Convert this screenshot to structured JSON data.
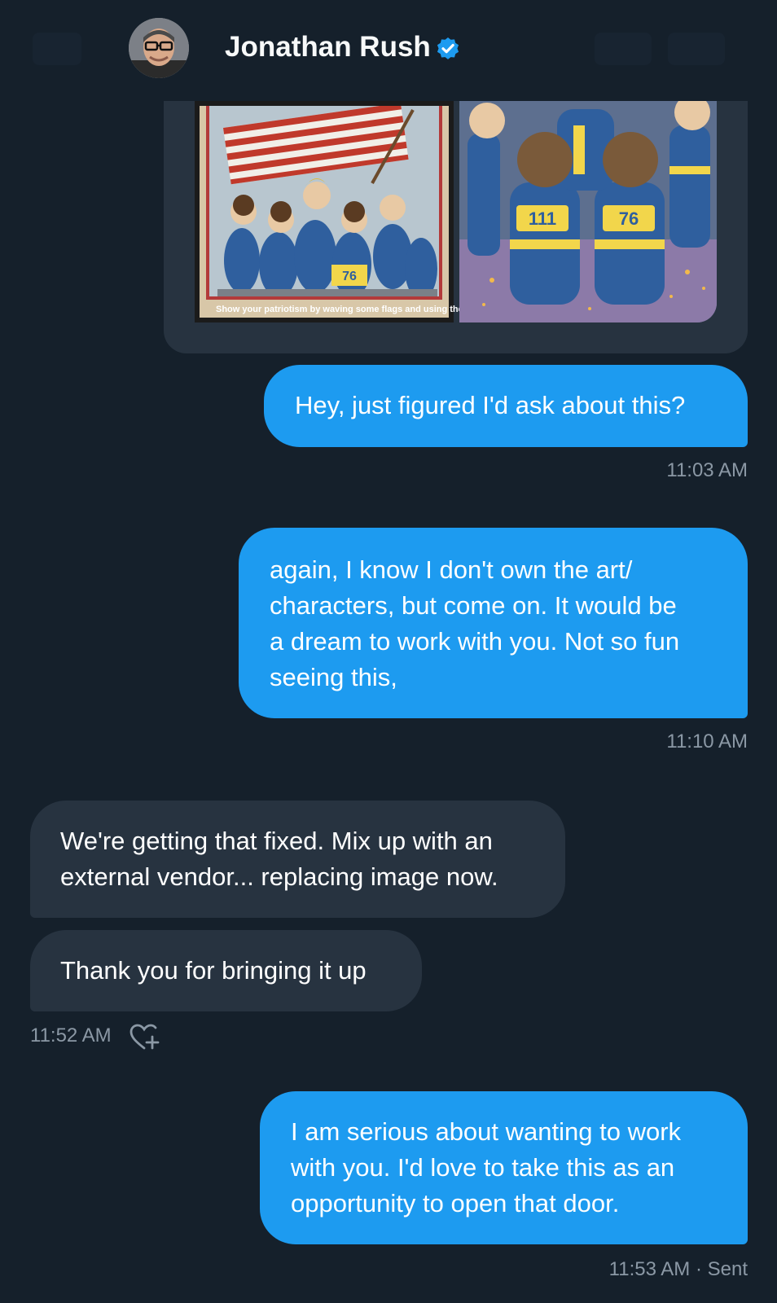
{
  "header": {
    "contact_name": "Jonathan Rush",
    "verified": true,
    "avatar_icon": "profile-photo"
  },
  "attachment": {
    "caption": "Show your patriotism by waving some flags and using these offerings.",
    "left_image_number": "76",
    "right_image_numbers": [
      "111",
      "76"
    ]
  },
  "messages": [
    {
      "direction": "sent",
      "text": "Hey, just figured I'd ask about this?",
      "time": "11:03 AM"
    },
    {
      "direction": "sent",
      "text": "again, I know I don't own the art/\ncharacters, but come on. It would be\na dream to work with you. Not so fun\nseeing this,",
      "time": "11:10 AM"
    },
    {
      "direction": "received",
      "text": "We're getting that fixed.  Mix up with an\nexternal vendor... replacing image now."
    },
    {
      "direction": "received",
      "text": "Thank you for bringing it up",
      "time": "11:52 AM",
      "reaction_icon": "add-reaction-heart-icon"
    },
    {
      "direction": "sent",
      "text": "I am serious about wanting to work\nwith you. I'd love to take this as an\nopportunity to open that door.",
      "time": "11:53 AM · Sent"
    }
  ],
  "colors": {
    "background": "#15202b",
    "sent_bubble": "#1d9bf0",
    "received_bubble": "#273340",
    "timestamp": "#8b98a5",
    "verified_badge": "#1d9bf0"
  }
}
